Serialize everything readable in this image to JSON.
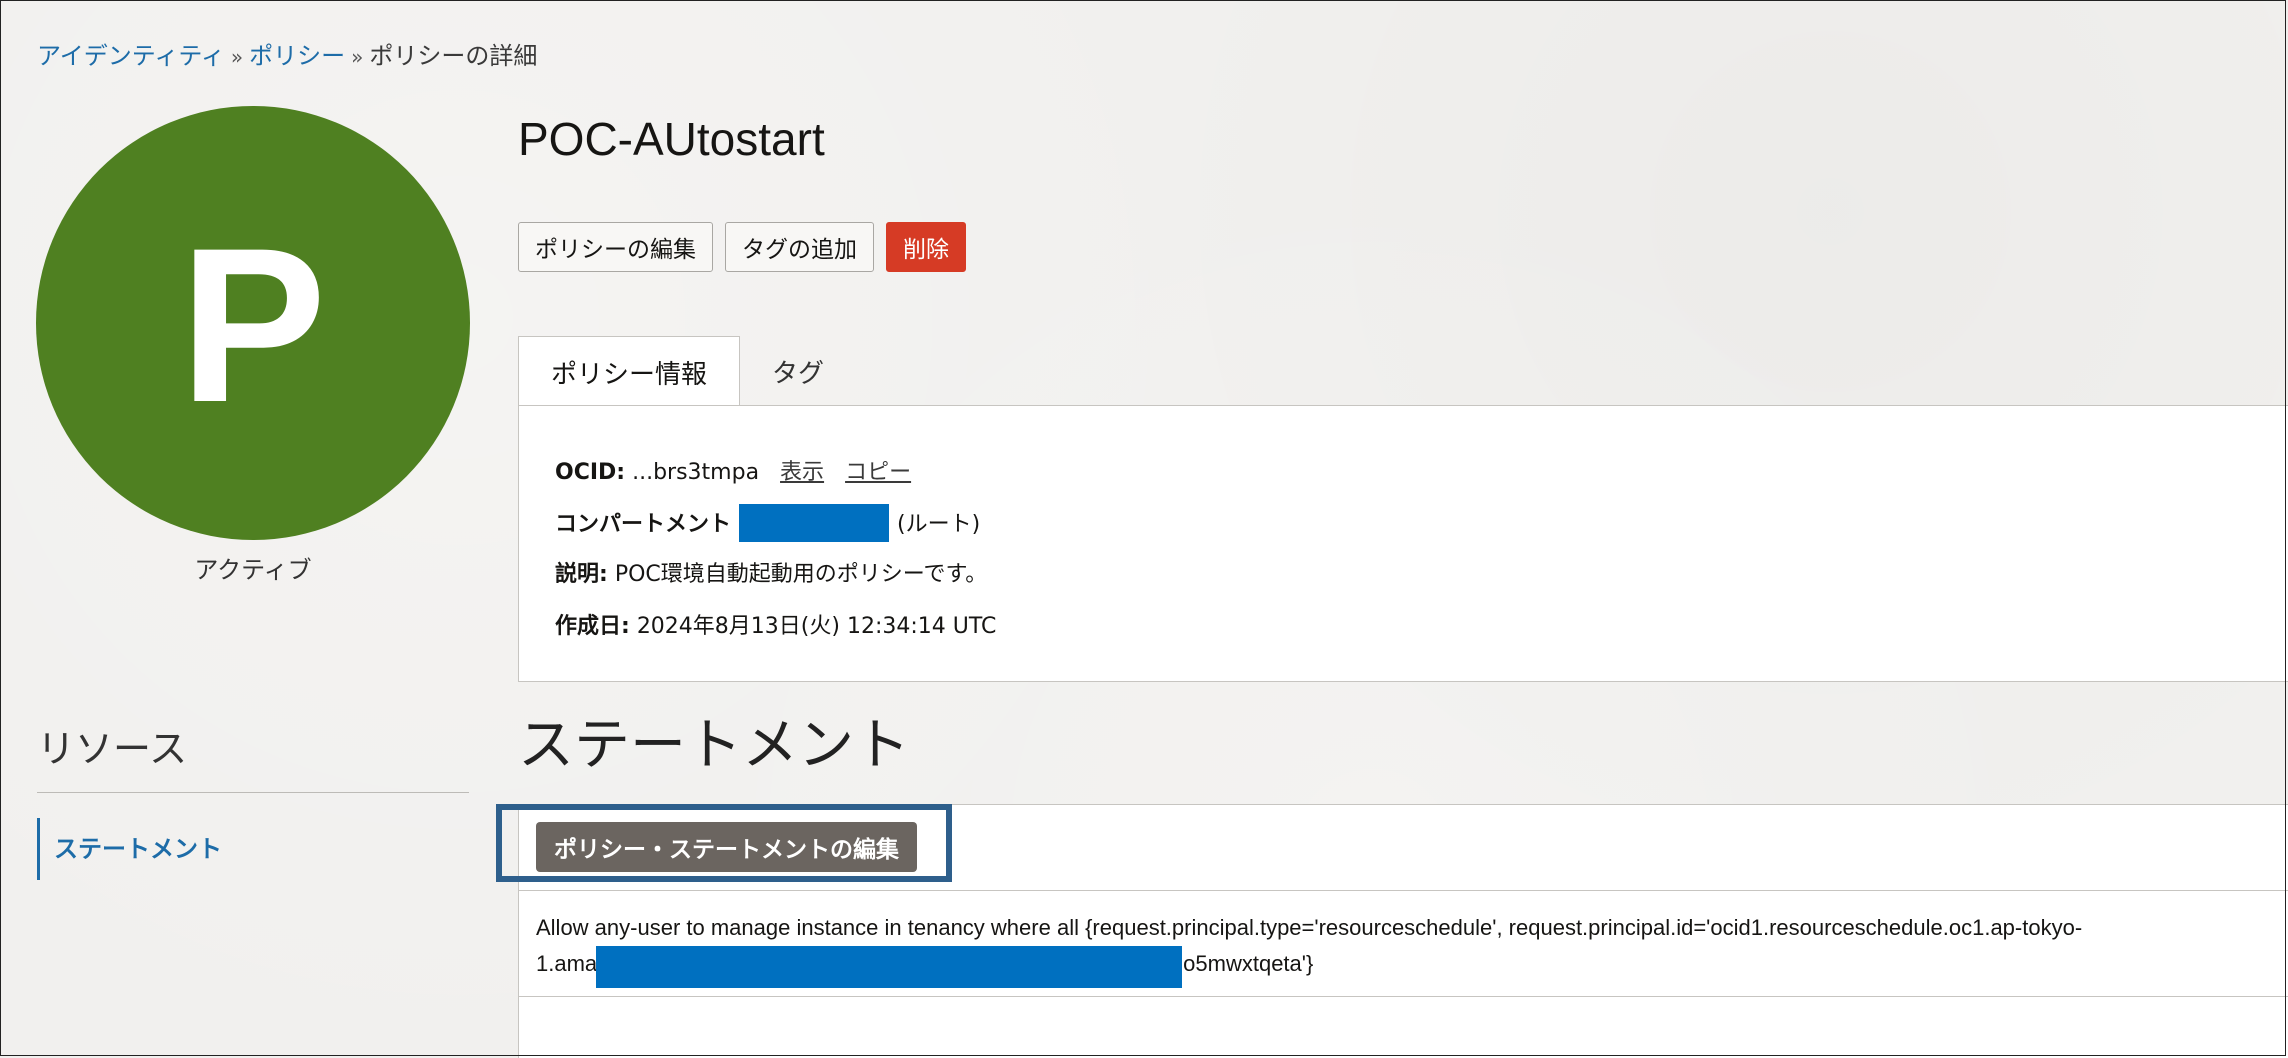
{
  "breadcrumb": {
    "item1": "アイデンティティ",
    "item2": "ポリシー",
    "current": "ポリシーの詳細",
    "separator": "»"
  },
  "avatar": {
    "letter": "P",
    "color": "#4f8021",
    "status": "アクティブ"
  },
  "resources": {
    "title": "リソース",
    "items": [
      {
        "label": "ステートメント"
      }
    ]
  },
  "policy": {
    "name": "POC-AUtostart"
  },
  "actions": {
    "edit_label": "ポリシーの編集",
    "add_tags_label": "タグの追加",
    "delete_label": "削除"
  },
  "tabs": [
    {
      "label": "ポリシー情報",
      "active": true
    },
    {
      "label": "タグ",
      "active": false
    }
  ],
  "info": {
    "ocid_label": "OCID:",
    "ocid_value": "...brs3tmpa",
    "show_link": "表示",
    "copy_link": "コピー",
    "compartment_label": "コンパートメント",
    "compartment_value": "(ルート)",
    "description_label": "説明:",
    "description_value": "POC環境自動起動用のポリシーです。",
    "created_label": "作成日:",
    "created_value": "2024年8月13日(火) 12:34:14 UTC"
  },
  "statements": {
    "title": "ステートメント",
    "edit_button": "ポリシー・ステートメントの編集",
    "line1": "Allow any-user to manage instance in tenancy where all {request.principal.type='resourceschedule', request.principal.id='ocid1.resourceschedule.oc1.ap-tokyo-",
    "line2_start": "1.ama",
    "line2_end": "o5mwxtqeta'}"
  },
  "colors": {
    "accent": "#1d6ca8",
    "danger": "#d63b25",
    "redaction": "#0070c0",
    "highlight": "#2e5f8c"
  }
}
